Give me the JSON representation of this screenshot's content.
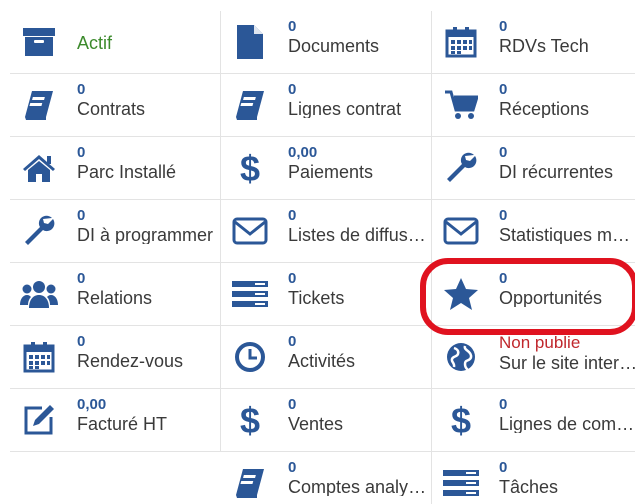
{
  "colors": {
    "icon": "#2b5797",
    "count": "#2b5797",
    "label": "#3a3a3a",
    "status_green": "#3c8a2c",
    "status_red": "#c0282d",
    "highlight": "#e0121f"
  },
  "rows": [
    [
      {
        "icon": "archive-icon",
        "count": "",
        "label": "Actif"
      },
      {
        "icon": "file-icon",
        "count": "0",
        "label": "Documents"
      },
      {
        "icon": "calendar-icon",
        "count": "0",
        "label": "RDVs Tech"
      }
    ],
    [
      {
        "icon": "book-icon",
        "count": "0",
        "label": "Contrats"
      },
      {
        "icon": "book-icon",
        "count": "0",
        "label": "Lignes contrat"
      },
      {
        "icon": "cart-icon",
        "count": "0",
        "label": "Réceptions"
      }
    ],
    [
      {
        "icon": "home-icon",
        "count": "0",
        "label": "Parc Installé"
      },
      {
        "icon": "dollar-icon",
        "count": "0,00",
        "label": "Paiements"
      },
      {
        "icon": "wrench-icon",
        "count": "0",
        "label": "DI récurrentes"
      }
    ],
    [
      {
        "icon": "wrench-icon",
        "count": "0",
        "label": "DI à programmer"
      },
      {
        "icon": "envelope-icon",
        "count": "0",
        "label": "Listes de diffusion"
      },
      {
        "icon": "envelope-icon",
        "count": "0",
        "label": "Statistiques mailing"
      }
    ],
    [
      {
        "icon": "users-icon",
        "count": "0",
        "label": "Relations"
      },
      {
        "icon": "list-icon",
        "count": "0",
        "label": "Tickets"
      },
      {
        "icon": "star-icon",
        "count": "0",
        "label": "Opportunités"
      }
    ],
    [
      {
        "icon": "calendar-icon",
        "count": "0",
        "label": "Rendez-vous"
      },
      {
        "icon": "clock-icon",
        "count": "0",
        "label": "Activités"
      },
      {
        "icon": "globe-icon",
        "count": "Non publie",
        "label": "Sur le site internet"
      }
    ],
    [
      {
        "icon": "edit-icon",
        "count": "0,00",
        "label": "Facturé HT"
      },
      {
        "icon": "dollar-icon",
        "count": "0",
        "label": "Ventes"
      },
      {
        "icon": "dollar-icon",
        "count": "0",
        "label": "Lignes de commande"
      }
    ],
    [
      null,
      {
        "icon": "book-icon",
        "count": "0",
        "label": "Comptes analytiques"
      },
      {
        "icon": "list-icon",
        "count": "0",
        "label": "Tâches"
      }
    ]
  ]
}
